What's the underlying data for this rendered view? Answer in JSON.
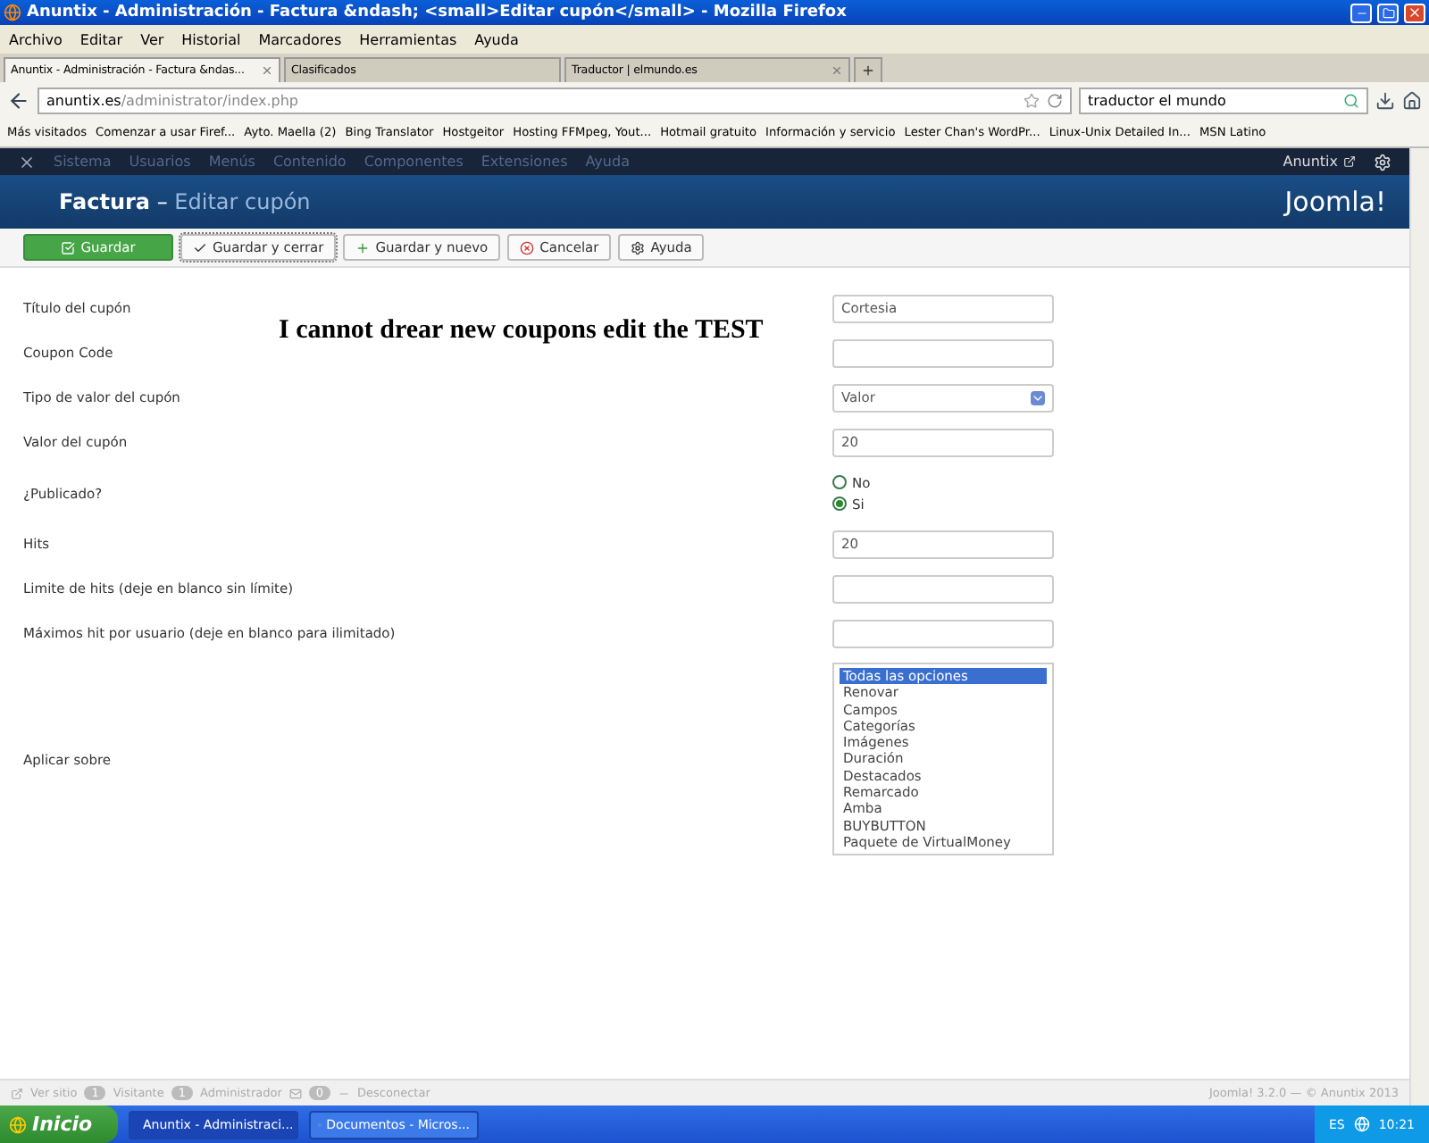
{
  "window": {
    "title": "Anuntix - Administración - Factura &ndash; <small>Editar cupón</small> - Mozilla Firefox"
  },
  "menu_bar": [
    "Archivo",
    "Editar",
    "Ver",
    "Historial",
    "Marcadores",
    "Herramientas",
    "Ayuda"
  ],
  "browser_tabs": [
    {
      "label": "Anuntix - Administración - Factura &ndas...",
      "selected": true
    },
    {
      "label": "Clasificados",
      "selected": false
    },
    {
      "label": "Traductor | elmundo.es",
      "selected": false
    }
  ],
  "address_bar": {
    "host": "anuntix.es",
    "path": "/administrator/index.php"
  },
  "search_field": {
    "value": "traductor el mundo"
  },
  "bookmarks": [
    "Más visitados",
    "Comenzar a usar Firef...",
    "Ayto. Maella (2)",
    "Bing Translator",
    "Hostgeitor",
    "Hosting FFMpeg, Yout...",
    "Hotmail gratuito",
    "Información y servicio",
    "Lester Chan's WordPr...",
    "Linux-Unix Detailed In...",
    "MSN Latino"
  ],
  "admin_nav": {
    "items": [
      "Sistema",
      "Usuarios",
      "Menús",
      "Contenido",
      "Componentes",
      "Extensiones",
      "Ayuda"
    ],
    "user": "Anuntix"
  },
  "header": {
    "component": "Factura",
    "separator": "–",
    "title": "Editar cupón",
    "logo": "Joomla!"
  },
  "toolbar": [
    {
      "label": "Guardar",
      "kind": "save"
    },
    {
      "label": "Guardar y cerrar",
      "kind": "check"
    },
    {
      "label": "Guardar y nuevo",
      "kind": "new"
    },
    {
      "label": "Cancelar",
      "kind": "cancel"
    },
    {
      "label": "Ayuda",
      "kind": "help"
    }
  ],
  "form": [
    {
      "kind": "text",
      "label": "Título del cupón",
      "value": "Cortesia"
    },
    {
      "kind": "text",
      "label": "Coupon Code"
    },
    {
      "kind": "select",
      "label": "Tipo de valor del cupón",
      "value": "Valor"
    },
    {
      "kind": "text",
      "label": "Valor del cupón",
      "value": "20"
    },
    {
      "kind": "radio",
      "label": "¿Publicado?",
      "options": [
        {
          "label": "No",
          "selected": false
        },
        {
          "label": "Si",
          "selected": true
        }
      ]
    },
    {
      "kind": "text",
      "label": "Hits",
      "value": "20"
    },
    {
      "kind": "text",
      "label": "Limite de hits (deje en blanco sin límite)"
    },
    {
      "kind": "text",
      "label": "Máximos hit por usuario (deje en blanco para ilimitado)"
    },
    {
      "kind": "list",
      "label": "Aplicar sobre",
      "options": [
        {
          "label": "Todas las opciones",
          "selected": true
        },
        {
          "label": "Renovar",
          "selected": false
        },
        {
          "label": "Campos",
          "selected": false
        },
        {
          "label": "Categorías",
          "selected": false
        },
        {
          "label": "Imágenes",
          "selected": false
        },
        {
          "label": "Duración",
          "selected": false
        },
        {
          "label": "Destacados",
          "selected": false
        },
        {
          "label": "Remarcado",
          "selected": false
        },
        {
          "label": "Amba",
          "selected": false
        },
        {
          "label": "BUYBUTTON",
          "selected": false
        },
        {
          "label": "Paquete de VirtualMoney",
          "selected": false
        }
      ]
    }
  ],
  "annotation": "I cannot drear new coupons edit the TEST",
  "status_bar": {
    "view_site": "Ver sitio",
    "visitors_count": "1",
    "visitors": "Visitante",
    "admins_count": "1",
    "admins": "Administrador",
    "messages_count": "0",
    "logout": "Desconectar",
    "footer": "Joomla! 3.2.0 — © Anuntix 2013"
  },
  "taskbar": {
    "start": "Inicio",
    "items": [
      {
        "label": "Anuntix - Administraci...",
        "selected": true
      },
      {
        "label": "Documentos - Micros...",
        "selected": false
      }
    ],
    "language": "ES",
    "clock": "10:21"
  }
}
